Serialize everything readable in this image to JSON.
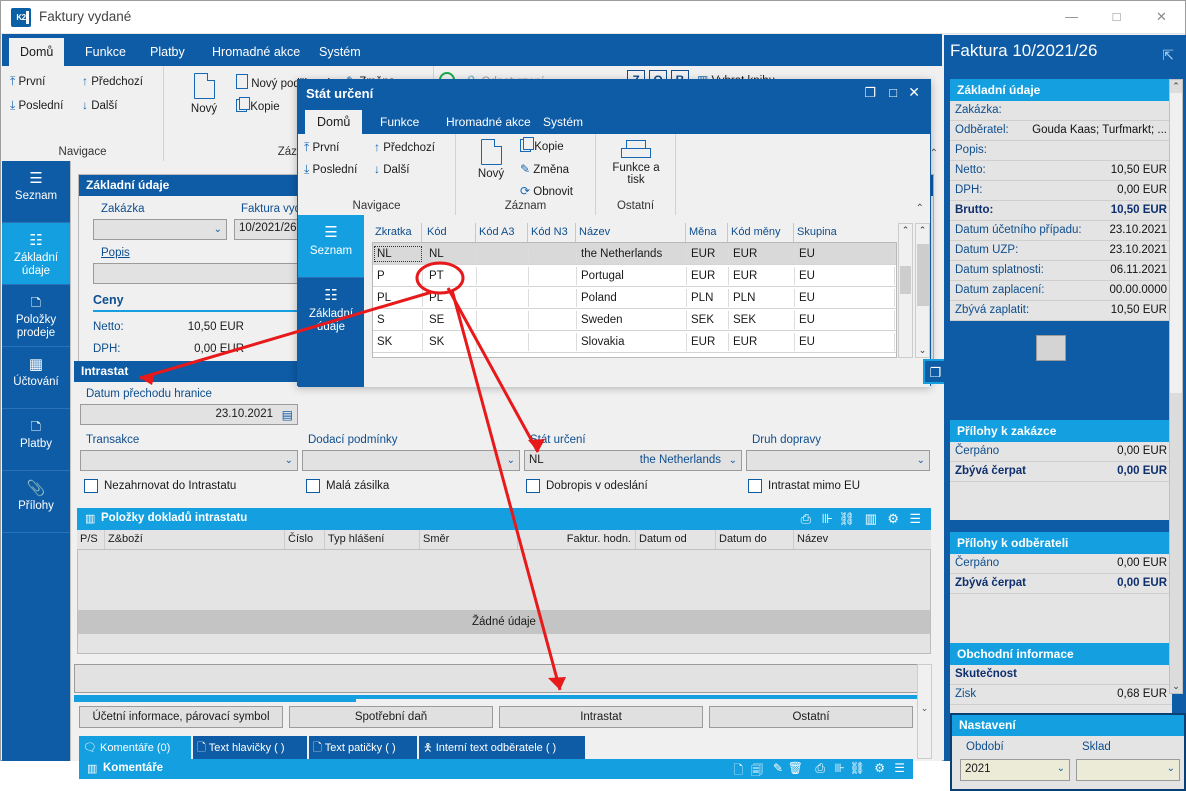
{
  "window": {
    "title": "Faktury vydané",
    "logo": "K2",
    "minimize": "—",
    "maximize": "□",
    "close": "✕"
  },
  "ribbon": {
    "tabs": [
      {
        "label": "Domů",
        "active": true
      },
      {
        "label": "Funkce",
        "active": false
      },
      {
        "label": "Platby",
        "active": false
      },
      {
        "label": "Hromadné akce",
        "active": false
      },
      {
        "label": "Systém",
        "active": false
      }
    ],
    "groups": [
      {
        "label": "Navigace",
        "items": [
          "První",
          "Předchozí",
          "Poslední",
          "Další"
        ]
      },
      {
        "label": "Záznam",
        "items": [
          "Nový",
          "Nový podřízený",
          "Kopie",
          "Změna"
        ]
      },
      {
        "label": "",
        "items": [
          "Odpotvrzení",
          "Z",
          "O",
          "B",
          "Vybrat knihu"
        ]
      }
    ]
  },
  "rail": [
    {
      "label": "Seznam",
      "icon": "list-icon",
      "active": false
    },
    {
      "label": "Základní údaje",
      "icon": "details-icon",
      "active": true
    },
    {
      "label": "Položky prodeje",
      "icon": "box-icon",
      "active": false
    },
    {
      "label": "Účtování",
      "icon": "calculator-icon",
      "active": false
    },
    {
      "label": "Platby",
      "icon": "box-icon",
      "active": false
    },
    {
      "label": "Přílohy",
      "icon": "paperclip-icon",
      "active": false
    }
  ],
  "basic": {
    "header": "Základní údaje",
    "zakazka_label": "Zakázka",
    "zakazka_value": "",
    "faktura_label": "Faktura vydaná",
    "faktura_value": "10/2021/26",
    "popis_label": "Popis",
    "popis_value": "",
    "ceny_label": "Ceny",
    "netto_label": "Netto:",
    "netto_value": "10,50 EUR",
    "dph_label": "DPH:",
    "dph_value": "0,00 EUR"
  },
  "intrastat": {
    "header": "Intrastat",
    "datum_label": "Datum přechodu hranice",
    "datum_value": "23.10.2021",
    "transakce_label": "Transakce",
    "transakce_value": "",
    "dodaci_label": "Dodací podmínky",
    "dodaci_value": "",
    "stat_label": "Stát určení",
    "stat_code": "NL",
    "stat_name": "the Netherlands",
    "doprava_label": "Druh dopravy",
    "doprava_value": "",
    "checkboxes": [
      {
        "label": "Nezahrnovat do Intrastatu",
        "checked": false
      },
      {
        "label": "Malá zásilka",
        "checked": false
      },
      {
        "label": "Dobropis v odeslání",
        "checked": false
      },
      {
        "label": "Intrastat mimo EU",
        "checked": false
      }
    ],
    "grid": {
      "title": "Položky dokladů intrastatu",
      "columns": [
        "P/S",
        "Z&boží",
        "Číslo",
        "Typ hlášení",
        "Směr",
        "Faktur. hodn.",
        "Datum od",
        "Datum do",
        "Název"
      ],
      "rows": [],
      "empty_text": "Žádné údaje"
    }
  },
  "bottom_buttons": [
    "Účetní informace, párovací symbol",
    "Spotřební daň",
    "Intrastat",
    "Ostatní"
  ],
  "bottom_tabs": [
    {
      "label": "Komentáře (0)",
      "icon": "comment-icon",
      "active": true
    },
    {
      "label": "Text hlavičky ( )",
      "icon": "doc-icon",
      "active": false
    },
    {
      "label": "Text patičky ( )",
      "icon": "doc-icon",
      "active": false
    },
    {
      "label": "Interní text odběratele ( )",
      "icon": "person-doc-icon",
      "active": false
    }
  ],
  "comments_panel": {
    "title": "Komentáře"
  },
  "dialog": {
    "title": "Stát určení",
    "buttons": {
      "restore": "❐",
      "maximize": "□",
      "close": "✕"
    },
    "tabs": [
      {
        "label": "Domů",
        "active": true
      },
      {
        "label": "Funkce",
        "active": false
      },
      {
        "label": "Hromadné akce",
        "active": false
      },
      {
        "label": "Systém",
        "active": false
      }
    ],
    "groups": [
      {
        "label": "Navigace",
        "items": [
          "První",
          "Předchozí",
          "Poslední",
          "Další"
        ]
      },
      {
        "label": "Záznam",
        "items": [
          "Nový",
          "Kopie",
          "Změna",
          "Obnovit"
        ]
      },
      {
        "label": "Ostatní",
        "items": [
          "Funkce a tisk"
        ]
      }
    ],
    "rail": [
      {
        "label": "Seznam",
        "icon": "list-icon",
        "active": true
      },
      {
        "label": "Základní údaje",
        "icon": "details-icon",
        "active": false
      }
    ],
    "table": {
      "columns": [
        "Zkratka",
        "Kód",
        "Kód A3",
        "Kód N3",
        "Název",
        "Měna",
        "Kód měny",
        "Skupina"
      ],
      "rows": [
        {
          "zkratka": "NL",
          "kod": "NL",
          "kod_a3": "",
          "kod_n3": "",
          "nazev": "the Netherlands",
          "mena": "EUR",
          "kod_meny": "EUR",
          "skupina": "EU",
          "selected": true
        },
        {
          "zkratka": "P",
          "kod": "PT",
          "kod_a3": "",
          "kod_n3": "",
          "nazev": "Portugal",
          "mena": "EUR",
          "kod_meny": "EUR",
          "skupina": "EU",
          "selected": false
        },
        {
          "zkratka": "PL",
          "kod": "PL",
          "kod_a3": "",
          "kod_n3": "",
          "nazev": "Poland",
          "mena": "PLN",
          "kod_meny": "PLN",
          "skupina": "EU",
          "selected": false
        },
        {
          "zkratka": "S",
          "kod": "SE",
          "kod_a3": "",
          "kod_n3": "",
          "nazev": "Sweden",
          "mena": "SEK",
          "kod_meny": "SEK",
          "skupina": "EU",
          "selected": false
        },
        {
          "zkratka": "SK",
          "kod": "SK",
          "kod_a3": "",
          "kod_n3": "",
          "nazev": "Slovakia",
          "mena": "EUR",
          "kod_meny": "EUR",
          "skupina": "EU",
          "selected": false
        }
      ]
    }
  },
  "right_panel": {
    "title": "Faktura 10/2021/26",
    "popout_icon": "popout-icon",
    "sections": [
      {
        "title": "Základní údaje",
        "rows": [
          {
            "k": "Zakázka:",
            "v": ""
          },
          {
            "k": "Odběratel:",
            "v": "Gouda Kaas; Turfmarkt; ..."
          },
          {
            "k": "Popis:",
            "v": ""
          },
          {
            "k": "Netto:",
            "v": "10,50 EUR"
          },
          {
            "k": "DPH:",
            "v": "0,00 EUR"
          },
          {
            "k": "Brutto:",
            "v": "10,50 EUR",
            "bold": true
          },
          {
            "k": "Datum účetního případu:",
            "v": "23.10.2021"
          },
          {
            "k": "Datum UZP:",
            "v": "23.10.2021"
          },
          {
            "k": "Datum splatnosti:",
            "v": "06.11.2021"
          },
          {
            "k": "Datum zaplacení:",
            "v": "00.00.0000"
          },
          {
            "k": "Zbývá zaplatit:",
            "v": "10,50 EUR"
          }
        ]
      },
      {
        "title": "Přílohy k zakázce",
        "rows": [
          {
            "k": "Čerpáno",
            "v": "0,00 EUR"
          },
          {
            "k": "Zbývá čerpat",
            "v": "0,00 EUR",
            "bold": true
          }
        ]
      },
      {
        "title": "Přílohy k odběrateli",
        "rows": [
          {
            "k": "Čerpáno",
            "v": "0,00 EUR"
          },
          {
            "k": "Zbývá čerpat",
            "v": "0,00 EUR",
            "bold": true
          }
        ]
      },
      {
        "title": "Obchodní informace",
        "rows": [
          {
            "k": "Skutečnost",
            "v": "",
            "bold": true
          },
          {
            "k": "Zisk",
            "v": "0,68 EUR"
          }
        ]
      }
    ],
    "settings": {
      "title": "Nastavení",
      "obdobi_label": "Období",
      "obdobi_value": "2021",
      "sklad_label": "Sklad",
      "sklad_value": ""
    }
  },
  "colors": {
    "ribbon_blue": "#0e5ba6",
    "accent_cyan": "#14a0e0",
    "annotation_red": "#e8191a",
    "panel_gray": "#e4e4e4"
  }
}
